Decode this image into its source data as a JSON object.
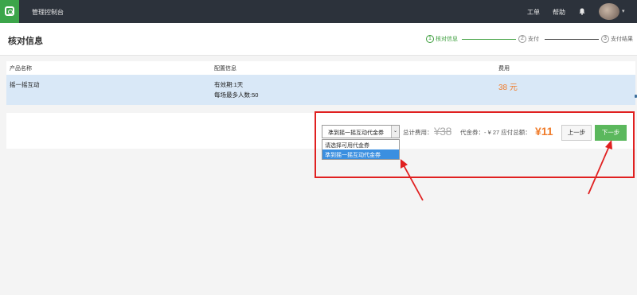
{
  "topbar": {
    "console_title": "管理控制台",
    "nav_work": "工单",
    "nav_help": "帮助",
    "avatar_caret": "▾",
    "bg_color": "#2c323b",
    "logo_color": "#3ca54a"
  },
  "header": {
    "title": "核对信息",
    "steps": [
      {
        "num": "1",
        "label": "核对信息",
        "state": "active"
      },
      {
        "num": "2",
        "label": "支付",
        "state": "pending"
      },
      {
        "num": "3",
        "label": "支付结果",
        "state": "pending"
      }
    ]
  },
  "table": {
    "columns": [
      "产品名称",
      "配置信息",
      "费用"
    ],
    "rows": [
      {
        "product": "摇一摇互动",
        "config_line1": "有效期:1天",
        "config_line2": "每场最多人数:50",
        "price": "38 元"
      }
    ]
  },
  "payment": {
    "voucher_select": {
      "value": "凖到摇一摇互动代金券",
      "options": [
        "请选择可用代金券",
        "凖到摇一摇互动代金券"
      ],
      "selected_index": 1
    },
    "total_label": "总计费用：",
    "total_original": "¥38",
    "voucher_label": "代金券：- ¥ 27  应付总额：",
    "amount_due": "¥11",
    "prev_label": "上一步",
    "next_label": "下一步"
  },
  "colors": {
    "accent_green": "#5bb85d",
    "price_orange": "#f07c2b",
    "annotation_red": "#e02020",
    "row_highlight": "#d9e8f7"
  }
}
